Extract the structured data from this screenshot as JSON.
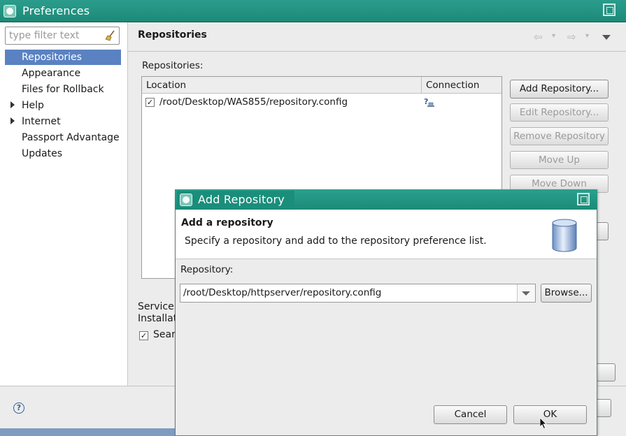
{
  "window": {
    "title": "Preferences"
  },
  "sidebar": {
    "filter_placeholder": "type filter text",
    "items": [
      {
        "label": "Repositories",
        "selected": true,
        "expandable": false
      },
      {
        "label": "Appearance",
        "selected": false,
        "expandable": false
      },
      {
        "label": "Files for Rollback",
        "selected": false,
        "expandable": false
      },
      {
        "label": "Help",
        "selected": false,
        "expandable": true
      },
      {
        "label": "Internet",
        "selected": false,
        "expandable": true
      },
      {
        "label": "Passport Advantage",
        "selected": false,
        "expandable": false
      },
      {
        "label": "Updates",
        "selected": false,
        "expandable": false
      }
    ]
  },
  "page": {
    "title": "Repositories",
    "repositories_label": "Repositories:",
    "table": {
      "columns": [
        "Location",
        "Connection"
      ],
      "rows": [
        {
          "checked": true,
          "location": "/root/Desktop/WAS855/repository.config",
          "connection_icon": "unknown-connection-icon"
        }
      ]
    },
    "buttons": {
      "add": "Add Repository...",
      "edit": "Edit Repository...",
      "remove": "Remove Repository",
      "move_up": "Move Up",
      "move_down": "Move Down"
    },
    "service_label": "Service",
    "install_label": "Installat",
    "search_label": "Sear",
    "search_checked": true
  },
  "dialog": {
    "title": "Add Repository",
    "heading": "Add a repository",
    "description": "Specify a repository and add to the repository preference list.",
    "repository_label": "Repository:",
    "repository_value": "/root/Desktop/httpserver/repository.config",
    "browse_label": "Browse...",
    "cancel_label": "Cancel",
    "ok_label": "OK"
  },
  "colors": {
    "titlebar": "#1d8a78",
    "selection": "#5a82c2",
    "default_button_border": "#5c84be"
  }
}
